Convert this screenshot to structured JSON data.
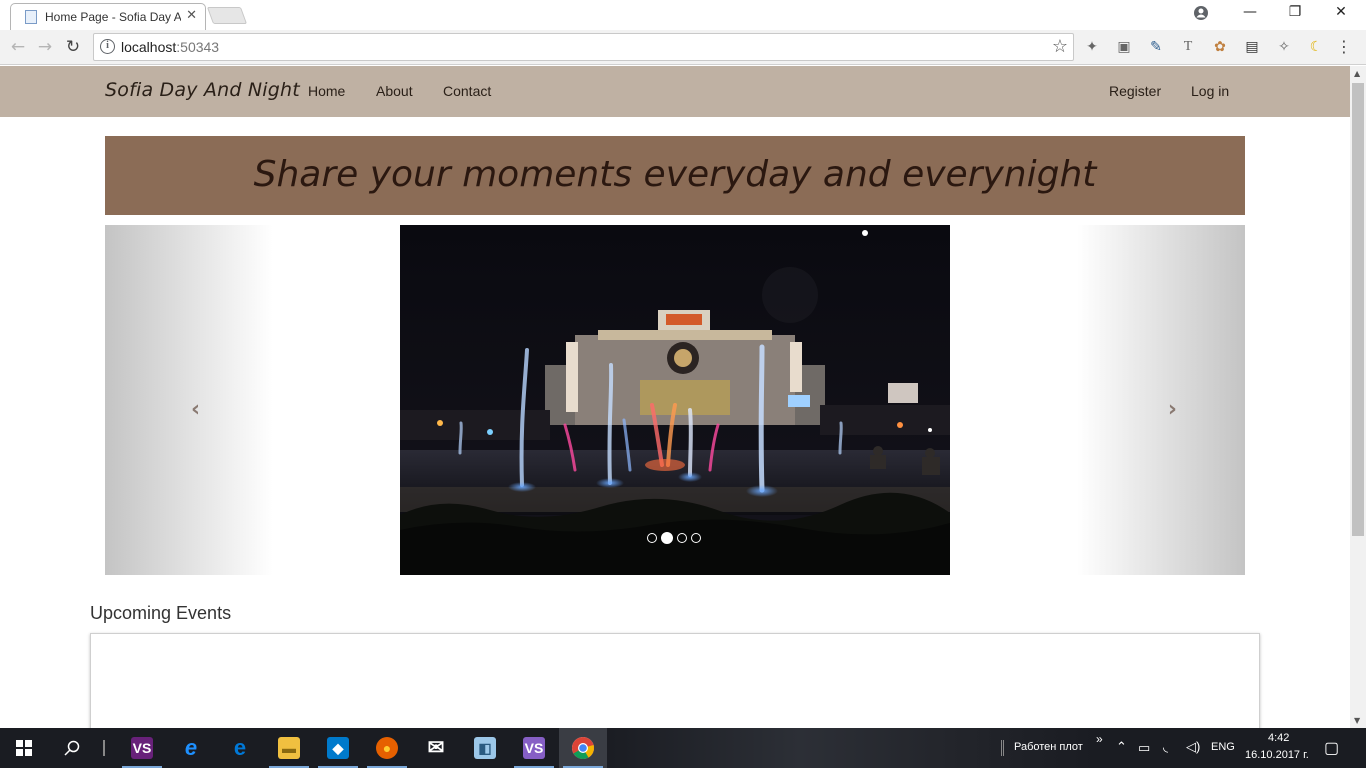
{
  "browser": {
    "tab_title": "Home Page - Sofia Day A",
    "tab_close": "✕",
    "url_host": "localhost",
    "url_port": ":50343",
    "window_controls": {
      "minimize": "—",
      "restore": "❐",
      "close": "✕"
    }
  },
  "site": {
    "brand": "Sofia Day And Night",
    "nav": [
      {
        "label": "Home"
      },
      {
        "label": "About"
      },
      {
        "label": "Contact"
      }
    ],
    "auth": [
      {
        "label": "Register"
      },
      {
        "label": "Log in"
      }
    ],
    "banner_text": "Share your moments everyday and everynight",
    "carousel": {
      "prev_glyph": "‹",
      "next_glyph": "›",
      "slide_count": 4,
      "active_index": 1
    },
    "events_title": "Upcoming Events"
  },
  "taskbar": {
    "apps": [
      {
        "name": "visual-studio-icon",
        "glyph": "VS",
        "color": "#68217a"
      },
      {
        "name": "internet-explorer-icon",
        "glyph": "e",
        "color": "#1e90ff"
      },
      {
        "name": "edge-icon",
        "glyph": "e",
        "color": "#0078d7"
      },
      {
        "name": "file-explorer-icon",
        "glyph": "▬",
        "color": "#f0c040"
      },
      {
        "name": "vscode-icon",
        "glyph": "◆",
        "color": "#007acc"
      },
      {
        "name": "firefox-icon",
        "glyph": "●",
        "color": "#e66000"
      },
      {
        "name": "mail-icon",
        "glyph": "✉",
        "color": "#ffffff"
      },
      {
        "name": "app-icon",
        "glyph": "◧",
        "color": "#9cc7e8"
      },
      {
        "name": "visual-studio-2-icon",
        "glyph": "VS",
        "color": "#865fc5"
      },
      {
        "name": "chrome-icon",
        "glyph": "◉",
        "color": "#db4437"
      }
    ],
    "desktop_label": "Работен плот",
    "language": "ENG",
    "time": "4:42",
    "date": "16.10.2017 г."
  }
}
